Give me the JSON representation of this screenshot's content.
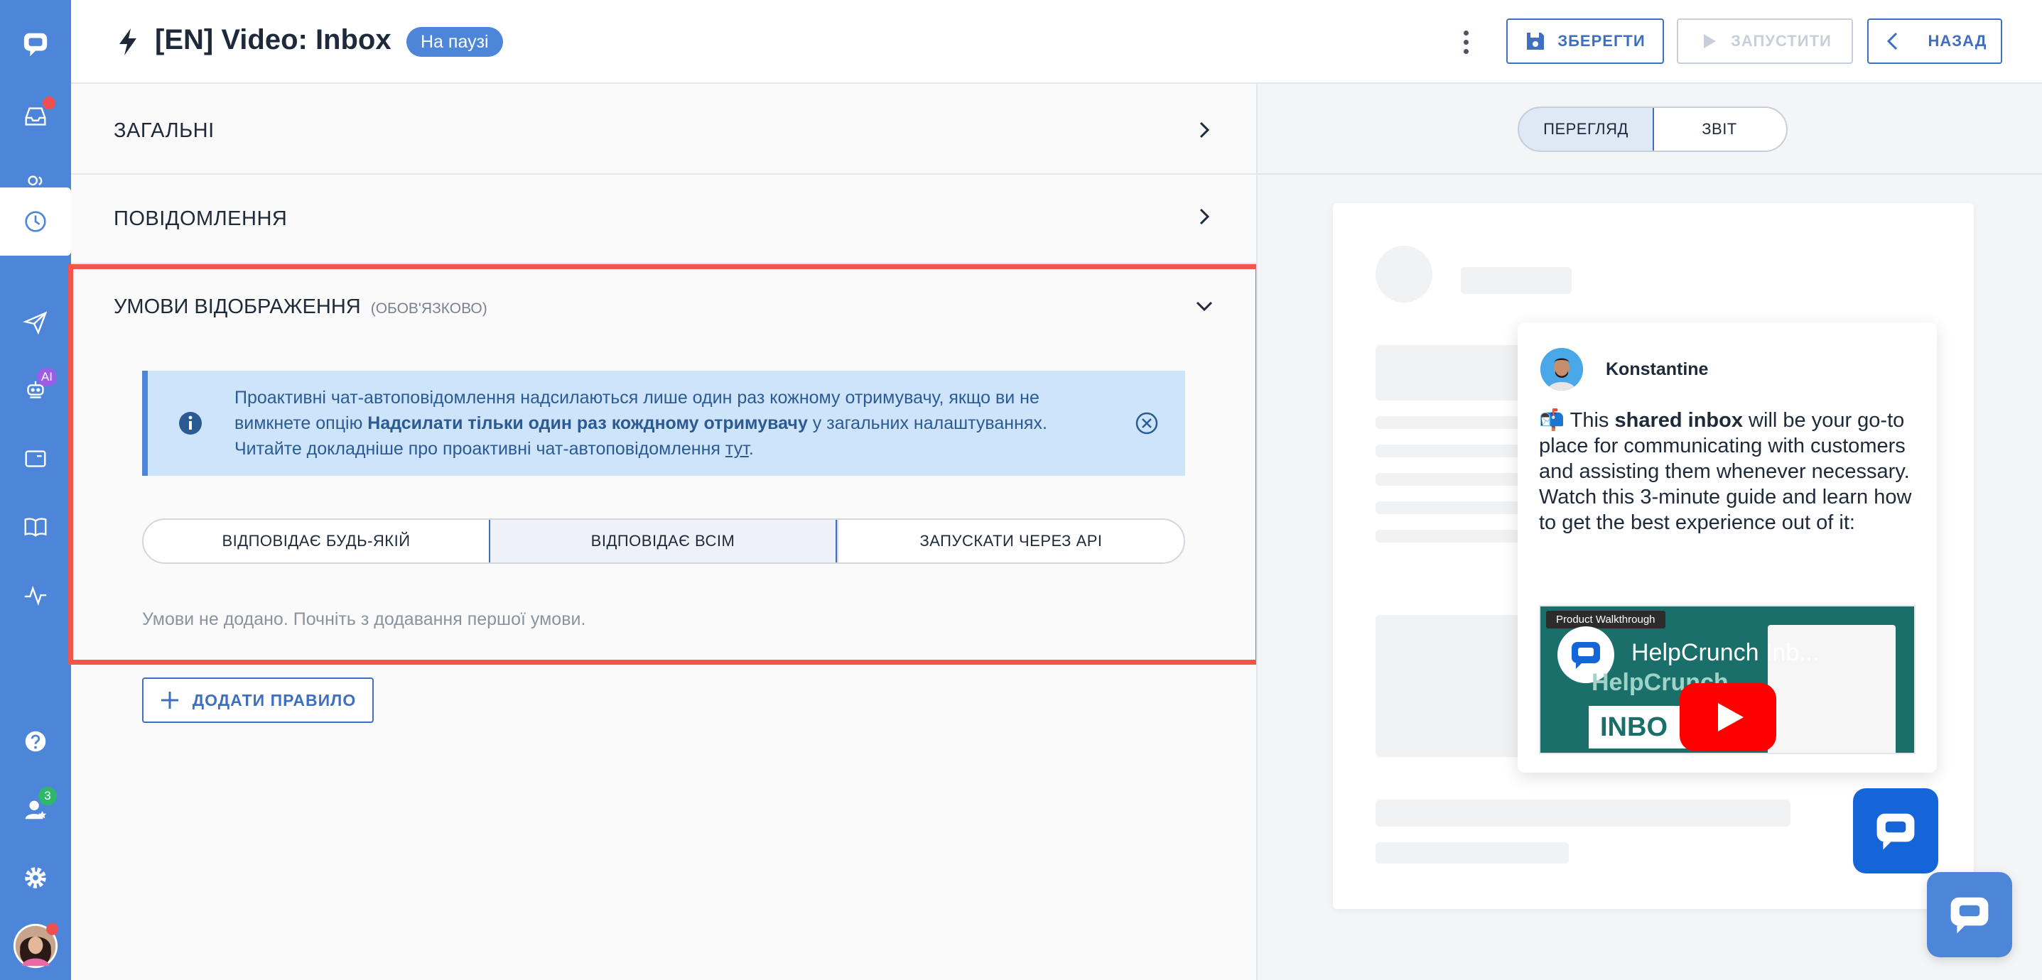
{
  "header": {
    "title": "[EN] Video: Inbox",
    "status": "На паузі",
    "save_label": "ЗБЕРЕГТИ",
    "run_label": "ЗАПУСТИТИ",
    "back_label": "НАЗАД"
  },
  "sidebar": {
    "team_badge": "3",
    "ai_badge": "AI"
  },
  "sections": {
    "general": "ЗАГАЛЬНІ",
    "messages": "ПОВІДОМЛЕННЯ",
    "conditions": "УМОВИ ВІДОБРАЖЕННЯ",
    "conditions_note": "(ОБОВ'ЯЗКОВО)"
  },
  "info": {
    "line1": "Проактивні чат-автоповідомлення надсилаються лише один раз кожному отримувачу, якщо ви не",
    "line2_pre": "вимкнете опцію ",
    "line2_bold": "Надсилати тільки один раз кождному отримувачу",
    "line2_post": " у загальних налаштуваннях.",
    "line3_pre": "Читайте докладніше про проактивні чат-автоповідомлення ",
    "line3_link": "тут",
    "line3_post": "."
  },
  "match_options": [
    {
      "label": "ВІДПОВІДАЄ БУДЬ-ЯКІЙ",
      "selected": false
    },
    {
      "label": "ВІДПОВІДАЄ ВСІМ",
      "selected": true
    },
    {
      "label": "ЗАПУСКАТИ ЧЕРЕЗ API",
      "selected": false
    }
  ],
  "empty_message": "Умови не додано. Почніть з додавання першої умови.",
  "add_rule_label": "ДОДАТИ ПРАВИЛО",
  "preview": {
    "tab_preview": "ПЕРЕГЛЯД",
    "tab_report": "ЗВІТ",
    "sender": "Konstantine",
    "msg_emoji": "📬",
    "msg_pre": " This ",
    "msg_bold": "shared inbox",
    "msg_post": " will be your go-to place for communicating with customers and assisting them whenever necessary. Watch this 3-minute guide and learn how to get the best experience out of it:",
    "video_label": "Product Walkthrough",
    "video_title": "HelpCrunch Inb...",
    "video_brand": "HelpCrunch",
    "video_inbox": "INBO"
  },
  "colors": {
    "sidebar": "#4d86d9",
    "accent": "#3f6fbe",
    "highlight_border": "#f0564a",
    "info_bg": "#cde4fb"
  }
}
